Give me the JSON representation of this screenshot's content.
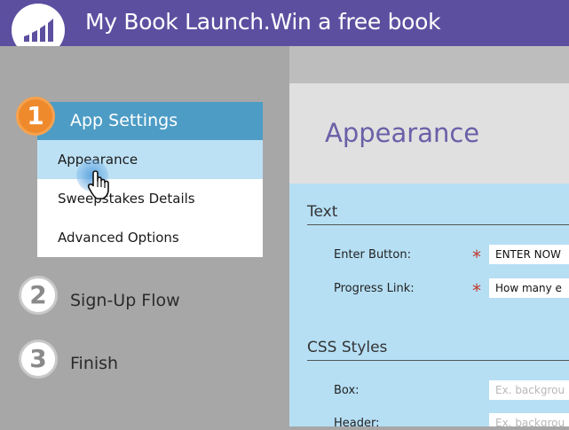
{
  "header": {
    "title": "My Book Launch.Win a free book"
  },
  "steps": [
    {
      "number": "1",
      "label": "App Settings"
    },
    {
      "number": "2",
      "label": "Sign-Up Flow"
    },
    {
      "number": "3",
      "label": "Finish"
    }
  ],
  "submenu": {
    "items": [
      {
        "label": "Appearance"
      },
      {
        "label": "Sweepstakes Details"
      },
      {
        "label": "Advanced Options"
      }
    ]
  },
  "main": {
    "heading": "Appearance",
    "text_section": {
      "title": "Text",
      "fields": [
        {
          "label": "Enter Button:",
          "required": "*",
          "value": "ENTER NOW"
        },
        {
          "label": "Progress Link:",
          "required": "*",
          "value": "How many e"
        }
      ]
    },
    "css_section": {
      "title": "CSS Styles",
      "fields": [
        {
          "label": "Box:",
          "placeholder": "Ex. backgrou"
        },
        {
          "label": "Header:",
          "placeholder": "Ex. backgrou"
        }
      ]
    }
  },
  "colors": {
    "header": "#5c4fa0",
    "active_step": "#ef8a2c",
    "app_settings_bar": "#4d9cc5",
    "selected_item": "#bde1f4",
    "form_background": "#b6dff4",
    "heading_text": "#6a60a8",
    "required_marker": "#c0392b"
  },
  "icons": {
    "logo": "marketo-bars-icon",
    "cursor": "hand-pointer-icon"
  }
}
